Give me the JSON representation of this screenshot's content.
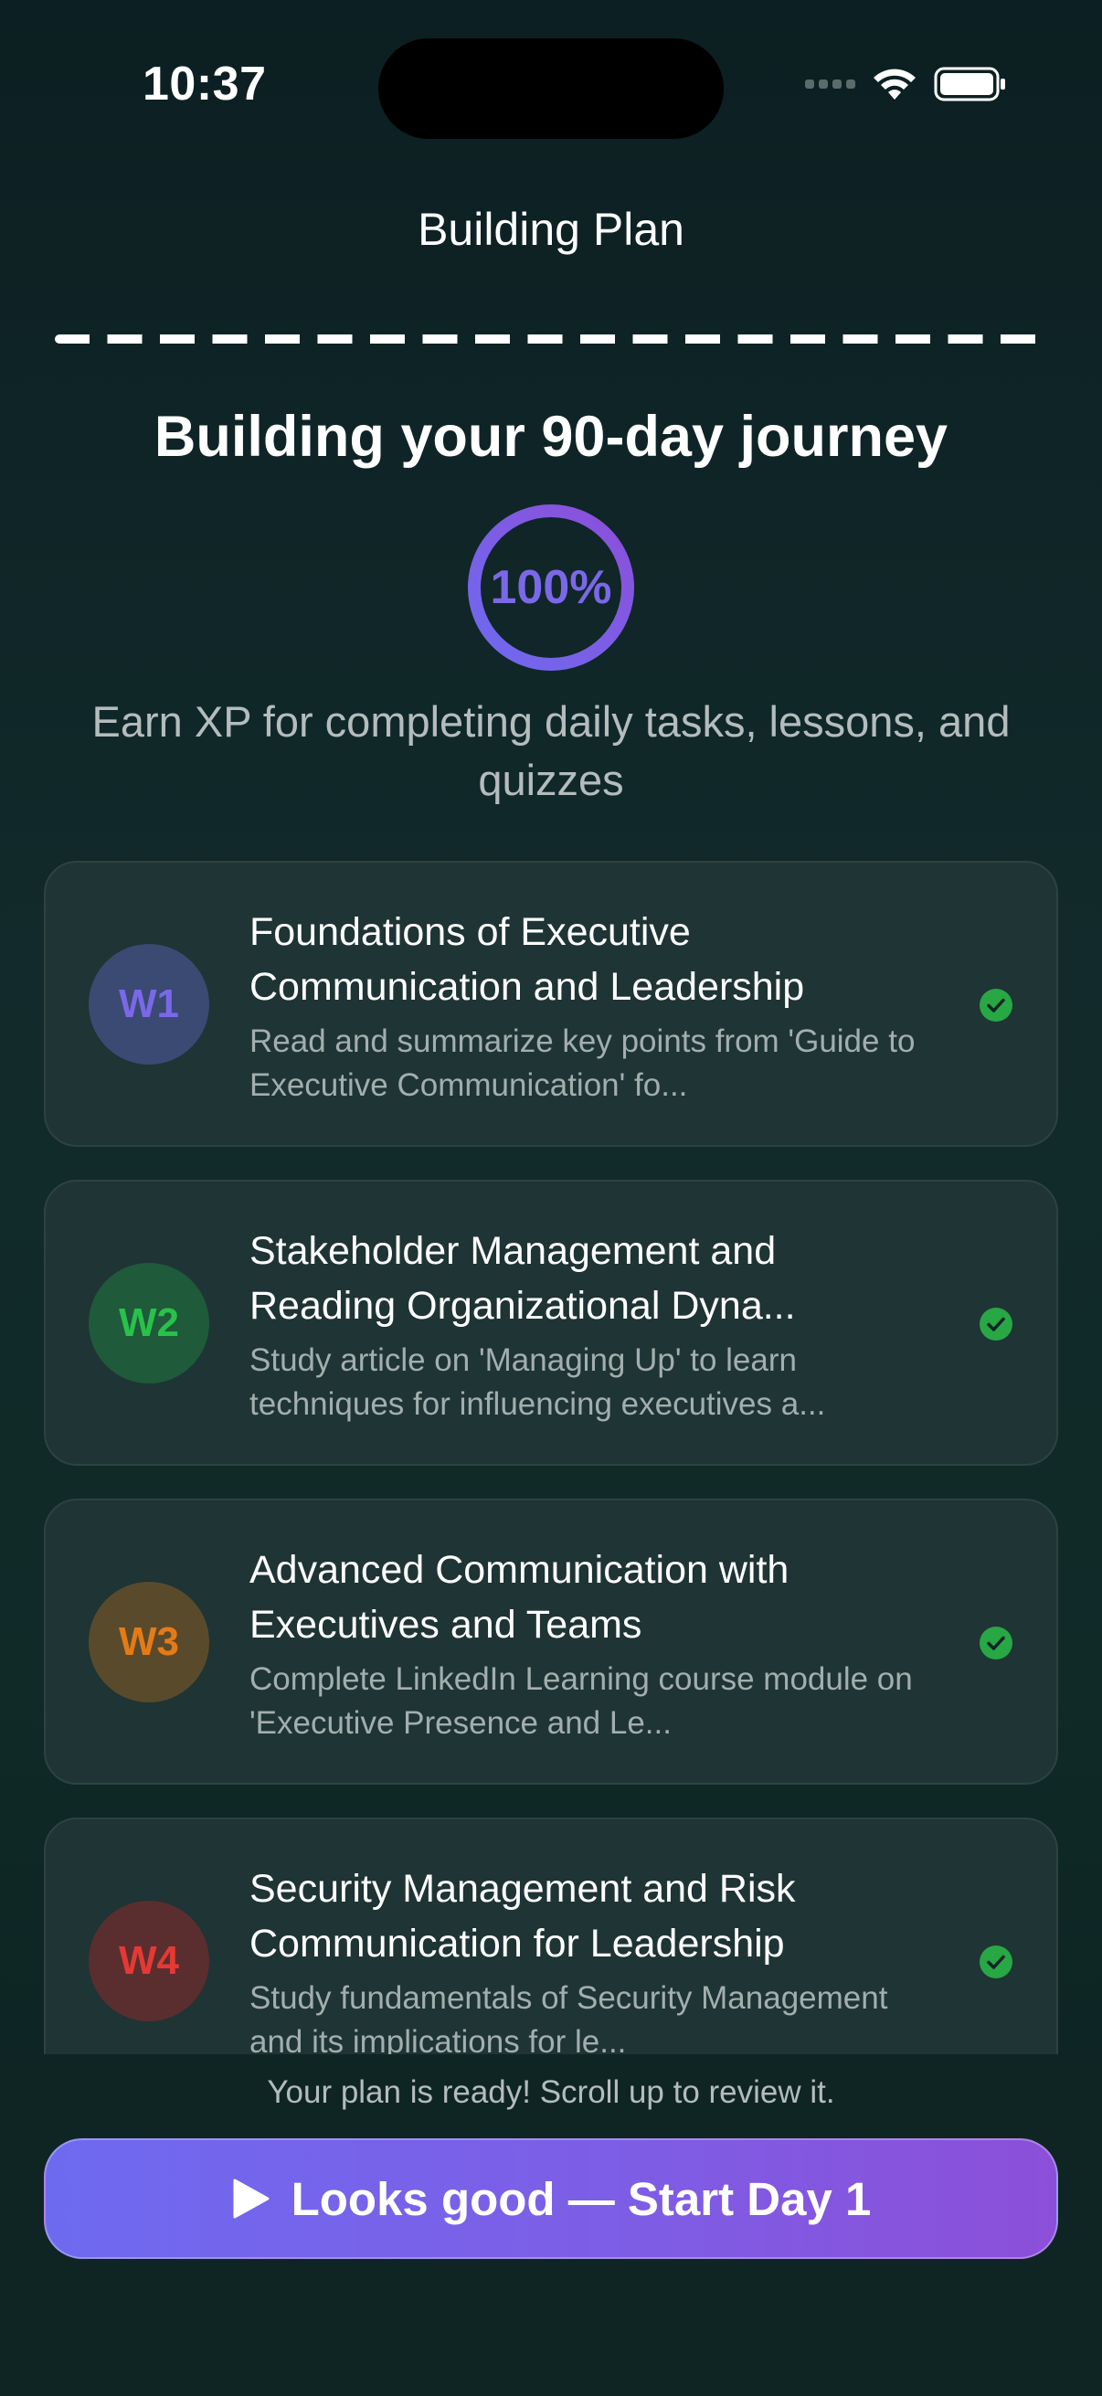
{
  "status_bar": {
    "time": "10:37",
    "icons": [
      "cellular-signal-icon",
      "wifi-icon",
      "battery-icon"
    ]
  },
  "nav": {
    "title": "Building Plan"
  },
  "hero": {
    "title": "Building your 90-day journey",
    "progress_text": "100%",
    "progress_fraction": 1.0,
    "subtitle": "Earn XP for completing daily tasks, lessons, and quizzes"
  },
  "weeks": [
    {
      "badge": "W1",
      "title": "Foundations of Executive Communication and Leadership",
      "description": "Read and summarize key points from 'Guide to Executive Communication' fo...",
      "completed": true,
      "badge_color": "#7b68e8",
      "badge_bg": "#3a4a73"
    },
    {
      "badge": "W2",
      "title": "Stakeholder Management and Reading Organizational Dyna...",
      "description": "Study article on 'Managing Up' to learn techniques for influencing executives a...",
      "completed": true,
      "badge_color": "#28c24a",
      "badge_bg": "#1f5a3a"
    },
    {
      "badge": "W3",
      "title": "Advanced Communication with Executives and Teams",
      "description": "Complete LinkedIn Learning course module on 'Executive Presence and Le...",
      "completed": true,
      "badge_color": "#e57b16",
      "badge_bg": "#5a4a2c"
    },
    {
      "badge": "W4",
      "title": "Security Management and Risk Communication for Leadership",
      "description": "Study fundamentals of Security Management and its implications for le...",
      "completed": true,
      "badge_color": "#e53935",
      "badge_bg": "#5a2e2e"
    }
  ],
  "footer": {
    "ready_text": "Your plan is ready! Scroll up to review it.",
    "button_label": "Looks good — Start Day 1",
    "button_icon": "play-icon"
  },
  "colors": {
    "accent": "#7b68e8",
    "success": "#28a745"
  }
}
